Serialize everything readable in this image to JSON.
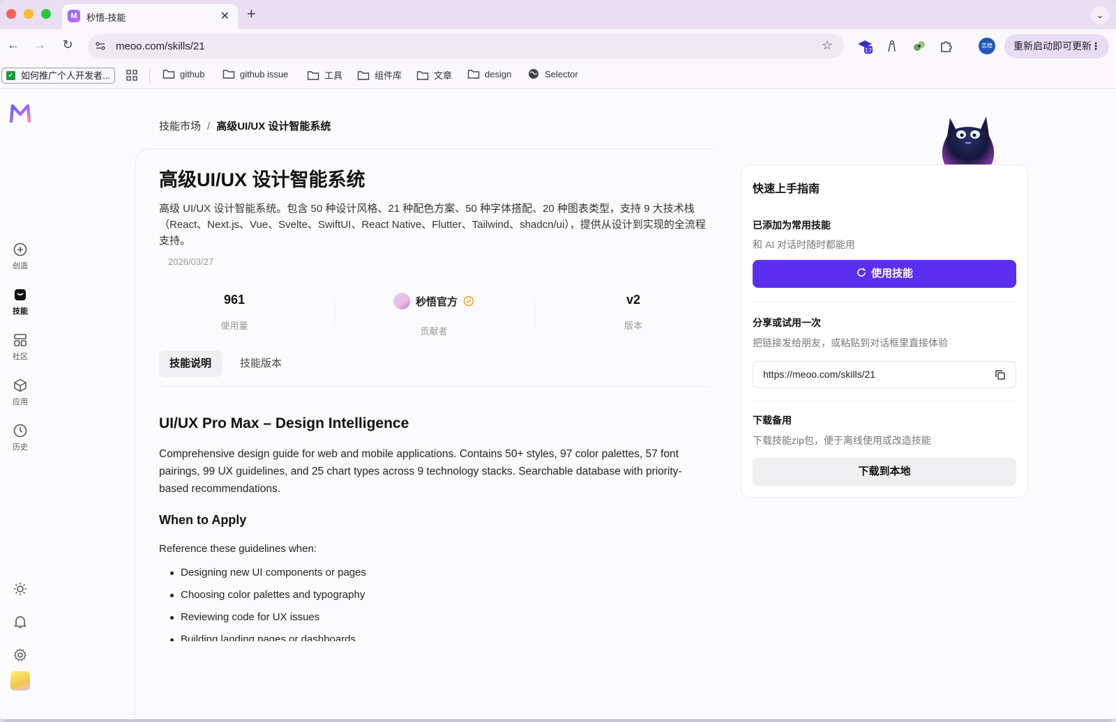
{
  "browser": {
    "tab_title": "秒悟-技能",
    "tab_favicon_text": "M",
    "url": "meoo.com/skills/21",
    "update_label": "重新启动即可更新",
    "profile_text": "志煌",
    "extension_badge": "17",
    "bookmarks": {
      "first": "如何推广个人开发者...",
      "items": [
        "github",
        "github issue",
        "工具",
        "组件库",
        "文章",
        "design",
        "Selector"
      ]
    }
  },
  "sidebar": {
    "items": [
      {
        "label": "创造",
        "icon": "plus-circle-icon"
      },
      {
        "label": "技能",
        "icon": "skill-bag-icon"
      },
      {
        "label": "社区",
        "icon": "grid-icon"
      },
      {
        "label": "应用",
        "icon": "cube-icon"
      },
      {
        "label": "历史",
        "icon": "clock-icon"
      }
    ],
    "bottom_icons": [
      "sun-icon",
      "bell-icon",
      "gear-icon"
    ]
  },
  "breadcrumb": {
    "parent": "技能市场",
    "separator": "/",
    "current": "高级UI/UX 设计智能系统"
  },
  "skill": {
    "title": "高级UI/UX 设计智能系统",
    "description": "高级 UI/UX 设计智能系统。包含 50 种设计风格、21 种配色方案、50 种字体搭配、20 种图表类型，支持 9 大技术栈（React、Next.js、Vue、Svelte、SwiftUI、React Native、Flutter、Tailwind、shadcn/ui），提供从设计到实现的全流程支持。",
    "date": "2026/03/27",
    "stats": {
      "usage_value": "961",
      "usage_label": "使用量",
      "contributor_name": "秒悟官方",
      "contributor_label": "贡献者",
      "version_value": "v2",
      "version_label": "版本"
    },
    "tabs": [
      "技能说明",
      "技能版本"
    ]
  },
  "content": {
    "h1": "UI/UX Pro Max – Design Intelligence",
    "intro": "Comprehensive design guide for web and mobile applications. Contains 50+ styles, 97 color palettes, 57 font pairings, 99 UX guidelines, and 25 chart types across 9 technology stacks. Searchable database with priority-based recommendations.",
    "h2": "When to Apply",
    "lead": "Reference these guidelines when:",
    "bullets": [
      "Designing new UI components or pages",
      "Choosing color palettes and typography",
      "Reviewing code for UX issues",
      "Building landing pages or dashboards"
    ]
  },
  "guide": {
    "title": "快速上手指南",
    "added_title": "已添加为常用技能",
    "added_sub": "和 AI 对话时随时都能用",
    "use_button": "使用技能",
    "share_title": "分享或试用一次",
    "share_sub": "把链接发给朋友，或粘贴到对话框里直接体验",
    "share_url": "https://meoo.com/skills/21",
    "download_title": "下载备用",
    "download_sub": "下载技能zip包，便于离线使用或改造技能",
    "download_button": "下载到本地"
  },
  "colors": {
    "primary": "#5b2ef0",
    "tabstrip": "#e9def3",
    "verified": "#f0a020"
  }
}
